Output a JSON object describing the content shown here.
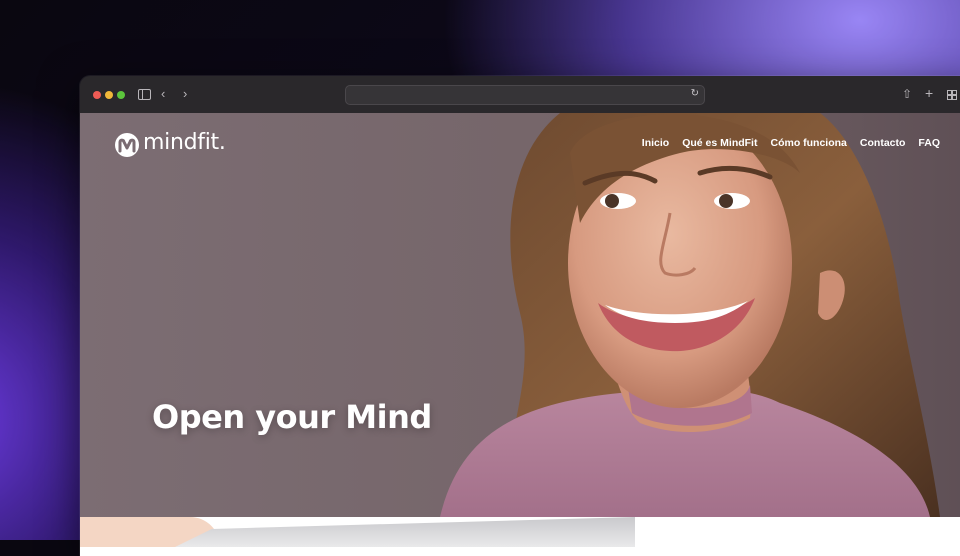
{
  "browser": {
    "address": "",
    "icons": {
      "sidebar": "sidebar-icon",
      "back": "chevron-left-icon",
      "forward": "chevron-right-icon",
      "reload": "reload-icon",
      "share": "share-icon",
      "new_tab": "plus-icon",
      "tabs": "tab-grid-icon"
    }
  },
  "site": {
    "logo_text": "mindfit.",
    "nav": [
      "Inicio",
      "Qué es MindFit",
      "Cómo funciona",
      "Contacto",
      "FAQ"
    ],
    "headline": "Open your Mind"
  },
  "colors": {
    "accent_purple": "#7b5cff",
    "hero_bg": "#7a6b72",
    "text_white": "#ffffff"
  }
}
